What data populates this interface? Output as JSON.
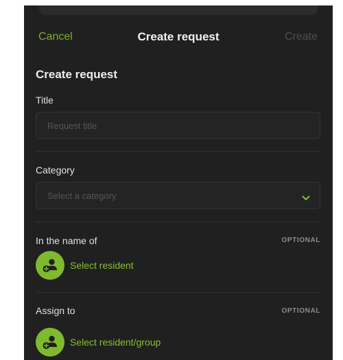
{
  "navbar": {
    "cancel": "Cancel",
    "title": "Create request",
    "create": "Create"
  },
  "form": {
    "heading": "Create request",
    "title_field": {
      "label": "Title",
      "placeholder": "Request title"
    },
    "category_field": {
      "label": "Category",
      "placeholder": "Select a category"
    },
    "name_of": {
      "label": "In the name of",
      "optional": "OPTIONAL",
      "action": "Select resident"
    },
    "assign_to": {
      "label": "Assign to",
      "optional": "OPTIONAL",
      "action": "Select resident/group"
    }
  },
  "icons": {
    "chevron": "chevron-down-icon",
    "resident": "add-person-icon"
  },
  "colors": {
    "accent": "#86c12f",
    "background": "#202020",
    "disabled": "#4e4e4e"
  }
}
